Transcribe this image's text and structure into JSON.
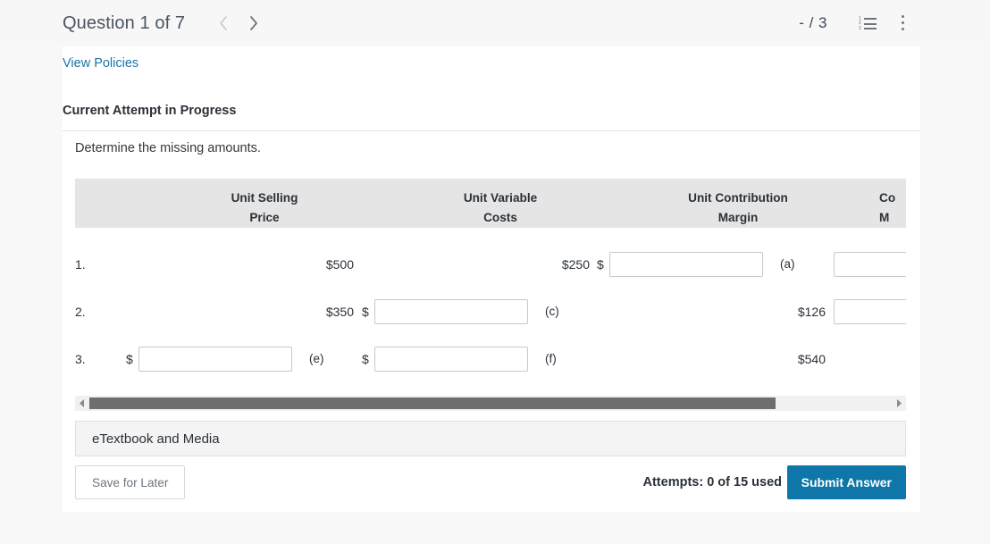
{
  "header": {
    "title": "Question 1 of 7",
    "prev_label": "Previous question",
    "next_label": "Next question",
    "score": "- / 3",
    "list_icon_name": "numbered-list-icon",
    "menu_icon_name": "kebab-menu-icon"
  },
  "card": {
    "view_policies": "View Policies",
    "attempt_heading": "Current Attempt in Progress",
    "prompt": "Determine the missing amounts."
  },
  "table": {
    "columns": [
      {
        "line1": "",
        "line2": ""
      },
      {
        "line1": "Unit Selling",
        "line2": "Price"
      },
      {
        "line1": "Unit Variable",
        "line2": "Costs"
      },
      {
        "line1": "Unit Contribution",
        "line2": "Margin"
      },
      {
        "line1": "Co",
        "line2": "M"
      }
    ],
    "rows": [
      {
        "number": "1.",
        "unit_selling_price": "$500",
        "unit_variable_costs": "$250",
        "unit_contribution_margin_prefix": "$",
        "unit_contribution_margin_value": "",
        "unit_contribution_margin_tag": "(a)",
        "contribution_margin_ratio_value": ""
      },
      {
        "number": "2.",
        "unit_selling_price": "$350",
        "unit_variable_costs_prefix": "$",
        "unit_variable_costs_value": "",
        "unit_variable_costs_tag": "(c)",
        "unit_contribution_margin": "$126",
        "contribution_margin_ratio_value": ""
      },
      {
        "number": "3.",
        "unit_selling_price_prefix": "$",
        "unit_selling_price_value": "",
        "unit_selling_price_tag": "(e)",
        "unit_variable_costs_prefix": "$",
        "unit_variable_costs_value": "",
        "unit_variable_costs_tag": "(f)",
        "unit_contribution_margin": "$540"
      }
    ]
  },
  "scrollbar": {
    "left_arrow": "◀",
    "right_arrow": "▶"
  },
  "etextbook": {
    "label": "eTextbook and Media"
  },
  "footer": {
    "save_label": "Save for Later",
    "attempts": "Attempts: 0 of 15 used",
    "submit_label": "Submit Answer"
  },
  "colors": {
    "accent_blue": "#0e76a8",
    "link_blue": "#1b75a8",
    "header_bg": "#e5e5e5",
    "scroll_thumb": "#6e6e6e"
  }
}
